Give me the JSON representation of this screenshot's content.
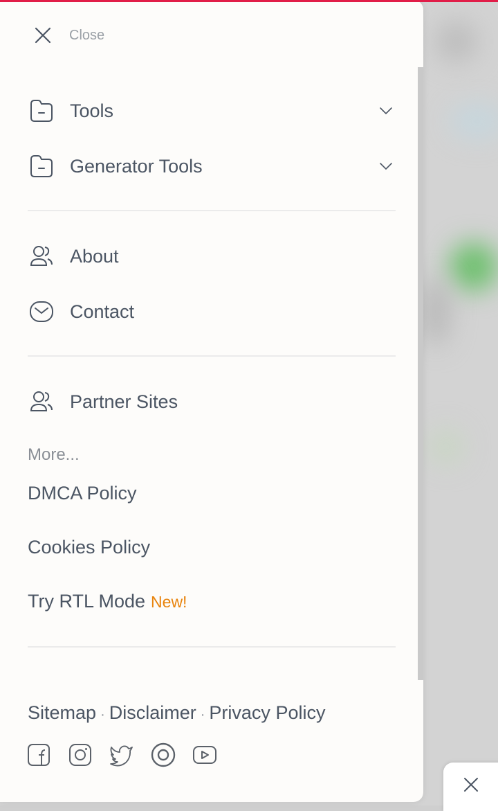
{
  "colors": {
    "accent_top_bar": "#e11d48",
    "new_badge": "#e8830c",
    "text": "#4b5563",
    "muted": "#9aa0a6"
  },
  "menu": {
    "close_label": "Close",
    "sections": [
      {
        "items": [
          {
            "label": "Tools",
            "icon": "folder-icon",
            "expandable": true
          },
          {
            "label": "Generator Tools",
            "icon": "folder-icon",
            "expandable": true
          }
        ]
      },
      {
        "items": [
          {
            "label": "About",
            "icon": "users-icon"
          },
          {
            "label": "Contact",
            "icon": "mail-icon"
          }
        ]
      },
      {
        "items": [
          {
            "label": "Partner Sites",
            "icon": "users-icon"
          }
        ]
      }
    ],
    "more_heading": "More...",
    "more_links": [
      {
        "label": "DMCA Policy"
      },
      {
        "label": "Cookies Policy"
      },
      {
        "label": "Try RTL Mode",
        "badge": "New!"
      }
    ]
  },
  "footer": {
    "links": [
      {
        "label": "Sitemap"
      },
      {
        "label": "Disclaimer"
      },
      {
        "label": "Privacy Policy"
      }
    ],
    "separator": "·",
    "social": [
      "facebook-icon",
      "instagram-icon",
      "twitter-icon",
      "circle-icon",
      "youtube-icon"
    ]
  }
}
